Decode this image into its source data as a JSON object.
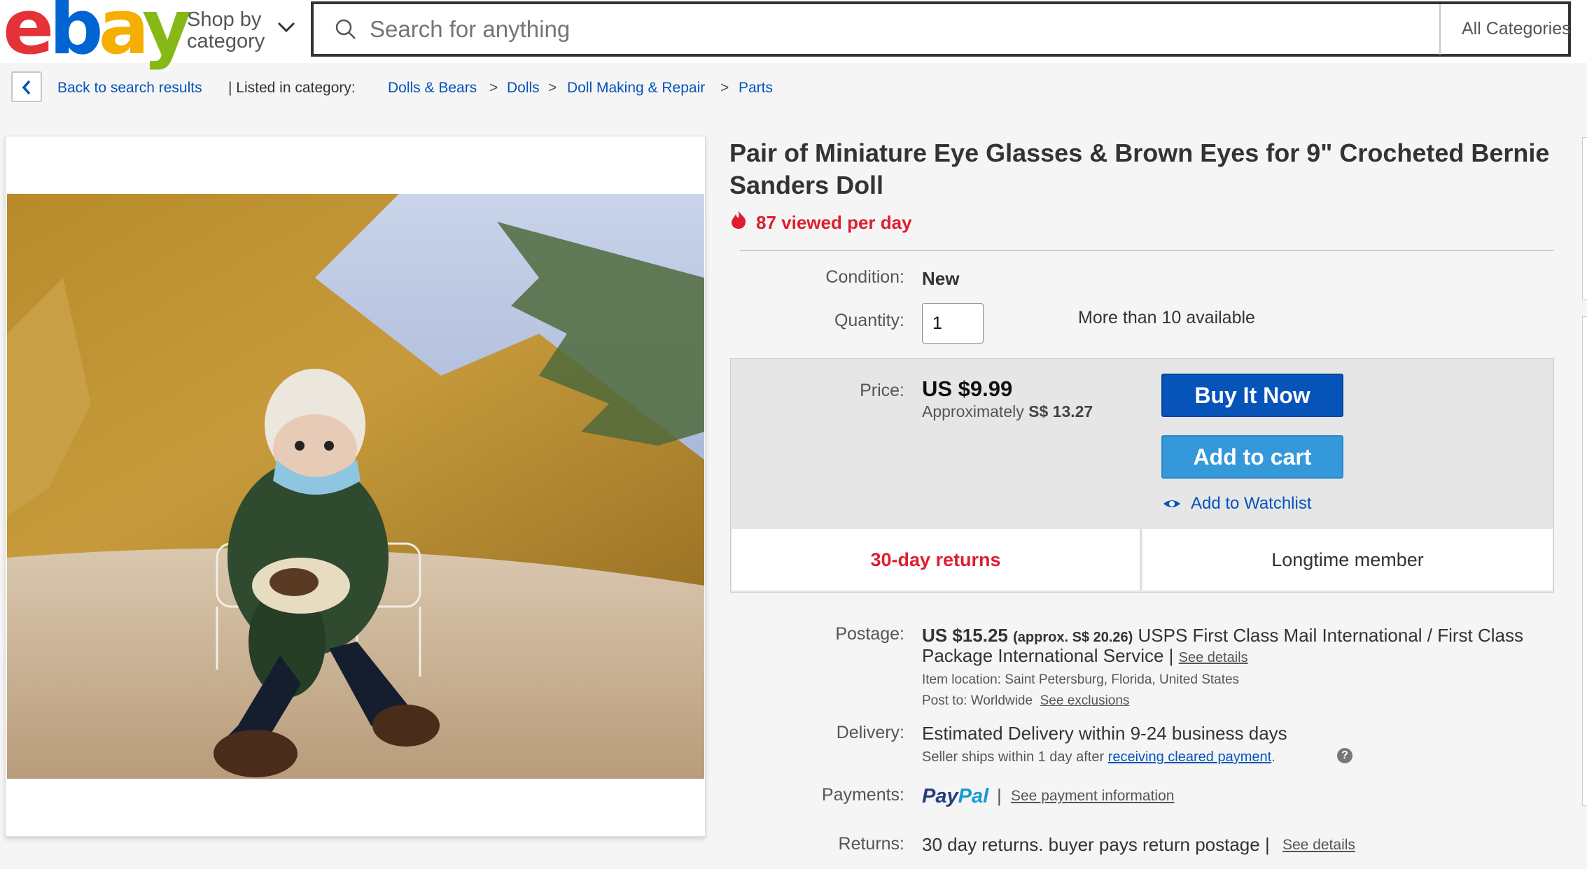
{
  "header": {
    "logo_letters": [
      "e",
      "b",
      "a",
      "y"
    ],
    "shop_by_line1": "Shop by",
    "shop_by_line2": "category",
    "search_placeholder": "Search for anything",
    "all_categories": "All Categories"
  },
  "breadcrumb": {
    "back": "Back to search results",
    "listed_in": "| Listed in category:",
    "items": [
      "Dolls & Bears",
      "Dolls",
      "Doll Making & Repair",
      "Parts"
    ],
    "separator": ">"
  },
  "product": {
    "title": "Pair of Miniature Eye Glasses & Brown Eyes for 9\" Crocheted Bernie Sanders Doll",
    "views": "87 viewed per day",
    "condition_label": "Condition:",
    "condition": "New",
    "quantity_label": "Quantity:",
    "quantity": "1",
    "availability": "More than 10 available",
    "price_label": "Price:",
    "price": "US $9.99",
    "approx_prefix": "Approximately",
    "approx_value": "S$ 13.27",
    "buy_now": "Buy It Now",
    "add_to_cart": "Add to cart",
    "watchlist": "Add to Watchlist",
    "returns_badge": "30-day returns",
    "member_badge": "Longtime member"
  },
  "shipping": {
    "postage_label": "Postage:",
    "postage_price": "US $15.25",
    "postage_approx": "(approx. S$ 20.26)",
    "postage_service_1": "USPS First Class Mail International / First Class",
    "postage_service_2": "Package International Service",
    "see_details": "See details",
    "item_location": "Item location: Saint Petersburg, Florida, United States",
    "post_to": "Post to: Worldwide",
    "see_exclusions": "See exclusions",
    "delivery_label": "Delivery:",
    "delivery": "Estimated Delivery within 9-24 business days",
    "seller_ships": "Seller ships within 1 day after",
    "cleared_payment": "receiving cleared payment",
    "help": "?",
    "payments_label": "Payments:",
    "paypal_1": "Pay",
    "paypal_2": "Pal",
    "payment_info": "See payment information",
    "returns_label": "Returns:",
    "returns": "30 day returns. buyer pays return postage",
    "returns_details": "See details"
  },
  "colors": {
    "accent_blue": "#0654ba",
    "alert_red": "#dd1e31",
    "buy_now": "#0654ba",
    "add_to_cart": "#3498db"
  }
}
